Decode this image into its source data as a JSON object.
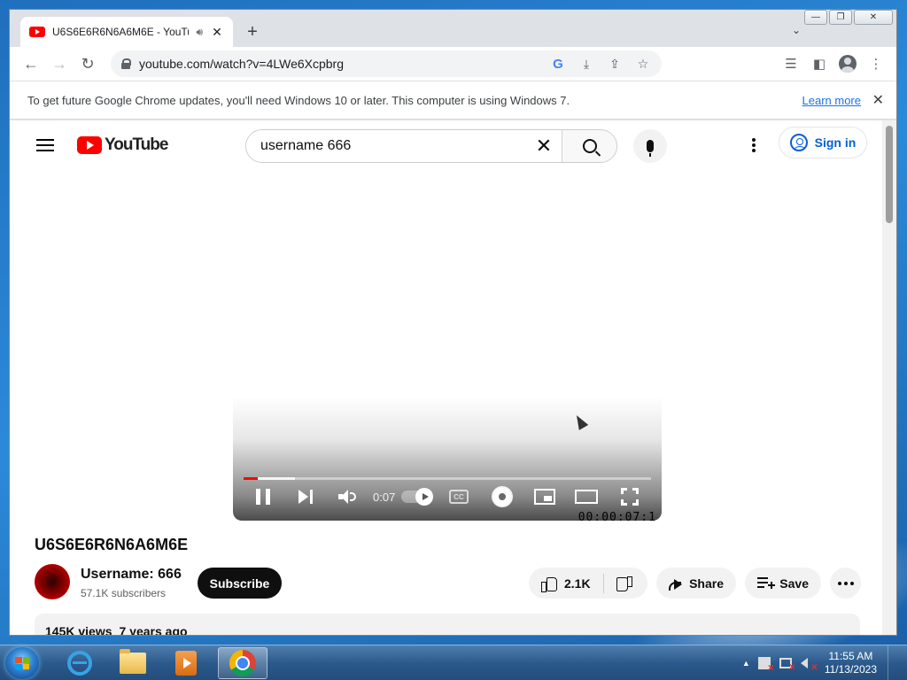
{
  "browser": {
    "tab": {
      "title": "U6S6E6R6N6A6M6E - YouTube",
      "audio_icon": "speaker-icon",
      "close_glyph": "✕"
    },
    "new_tab_glyph": "+",
    "tab_list_glyph": "⌄",
    "caption": {
      "minimize": "—",
      "maximize": "❐",
      "close": "✕"
    },
    "nav": {
      "back": "←",
      "forward": "→",
      "reload": "↻"
    },
    "url": "youtube.com/watch?v=4LWe6Xcpbrg",
    "omnibox_icons": {
      "google": "G",
      "install": "⤓",
      "share": "⇪",
      "bookmark": "☆"
    },
    "toolbar_icons": {
      "reading_list": "☰",
      "side_panel": "◧",
      "menu": "⋮"
    }
  },
  "infobar": {
    "message": "To get future Google Chrome updates, you'll need Windows 10 or later. This computer is using Windows 7.",
    "link": "Learn more",
    "close_glyph": "✕"
  },
  "youtube": {
    "logo_text": "YouTube",
    "search": {
      "value": "username 666",
      "clear_glyph": "✕"
    },
    "sign_in_label": "Sign in",
    "player": {
      "time": "0:07",
      "cc_label": "CC",
      "progress_played_fraction": 0.035,
      "progress_buffered_fraction": 0.126,
      "overlay_text": "00:00:07:1"
    },
    "video": {
      "title": "U6S6E6R6N6A6M6E",
      "channel_name": "Username: 666",
      "subscribers": "57.1K subscribers",
      "subscribe_label": "Subscribe",
      "likes": "2.1K",
      "share_label": "Share",
      "save_label": "Save",
      "views": "145K views",
      "age": "7 years ago"
    }
  },
  "taskbar": {
    "items": [
      "internet-explorer",
      "windows-explorer",
      "windows-media-player",
      "google-chrome"
    ],
    "active_item": "google-chrome",
    "tray_chevron": "▲",
    "clock": {
      "time": "11:55 AM",
      "date": "11/13/2023"
    }
  },
  "colors": {
    "youtube_red": "#ff0000",
    "link_blue": "#1a73e8",
    "signin_blue": "#065fd4",
    "chrome_frame": "#dee1e6"
  }
}
